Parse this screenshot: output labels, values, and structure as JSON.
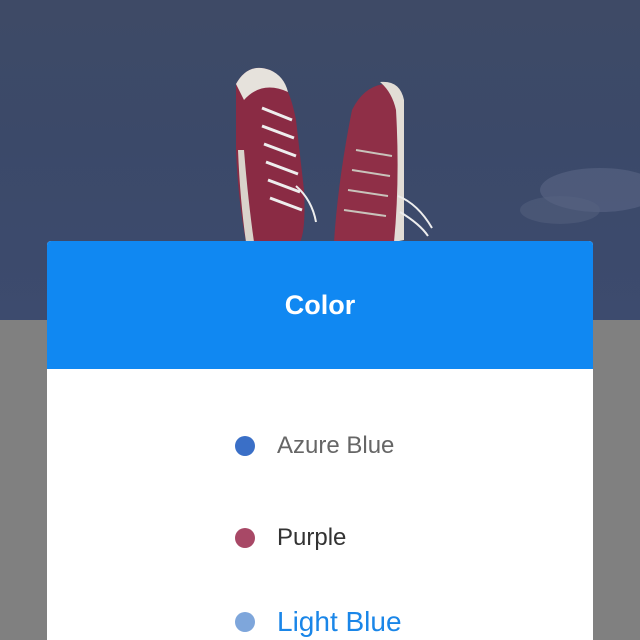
{
  "background": {
    "image": "sneakers-hanging-against-blue-sky",
    "overlay_color": "#808080"
  },
  "dialog": {
    "title": "Color",
    "header_color": "#1088f2",
    "options": [
      {
        "label": "Azure Blue",
        "swatch": "#3a6fc7",
        "state": "default"
      },
      {
        "label": "Purple",
        "swatch": "#a84866",
        "state": "default"
      },
      {
        "label": "Light Blue",
        "swatch": "#7ea6db",
        "state": "highlighted"
      }
    ]
  }
}
